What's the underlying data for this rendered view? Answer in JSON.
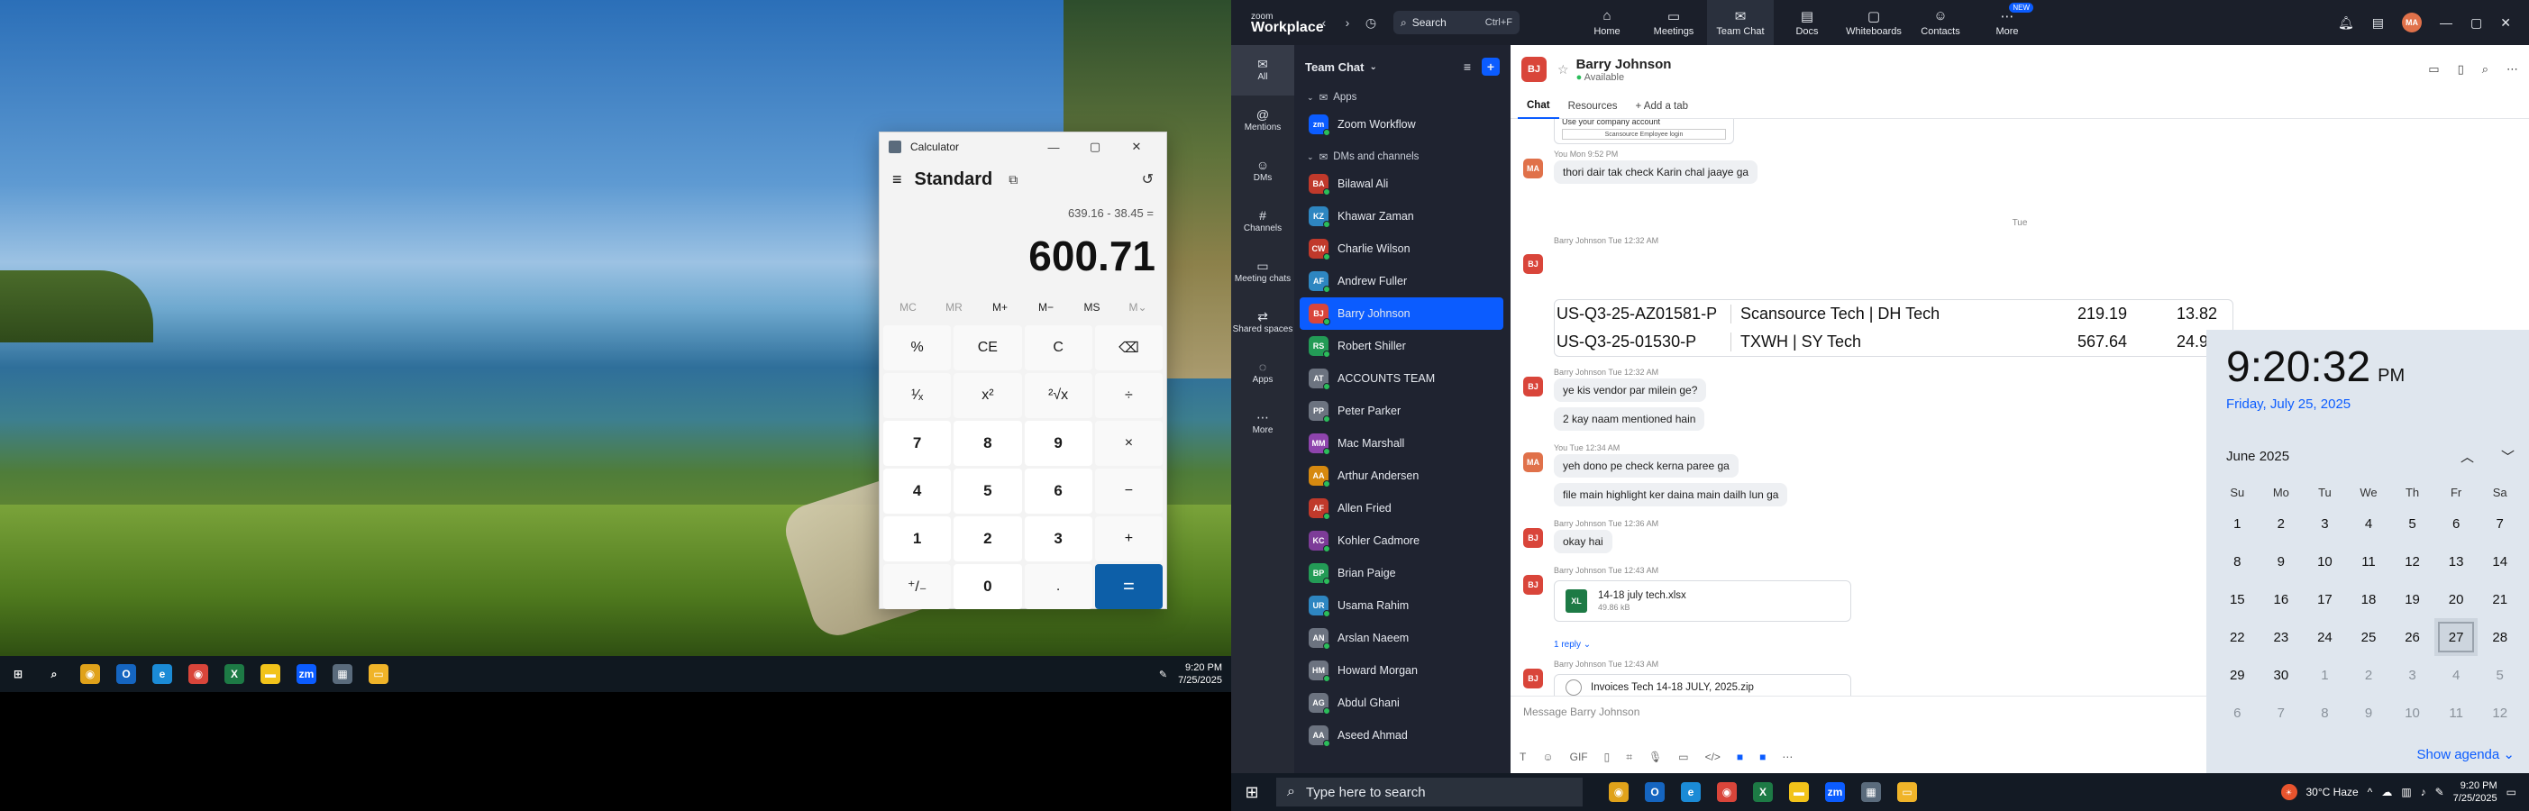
{
  "left_taskbar": {
    "time": "9:20 PM",
    "date": "7/25/2025",
    "apps": [
      {
        "name": "windows-start-icon",
        "glyph": "⊞",
        "color": "#ffffff"
      },
      {
        "name": "search-icon",
        "glyph": "⌕",
        "color": "#ffffff"
      },
      {
        "name": "chrome-icon",
        "glyph": "◉",
        "color": "#e0a21a"
      },
      {
        "name": "outlook-icon",
        "glyph": "O",
        "color": "#1565c0"
      },
      {
        "name": "edge-icon",
        "glyph": "e",
        "color": "#1b8bd6"
      },
      {
        "name": "chrome-icon-2",
        "glyph": "◉",
        "color": "#d9453a"
      },
      {
        "name": "excel-icon",
        "glyph": "X",
        "color": "#1d7a45"
      },
      {
        "name": "sticky-notes-icon",
        "glyph": "▬",
        "color": "#f2c31a"
      },
      {
        "name": "zoom-icon",
        "glyph": "zm",
        "color": "#0b5cff"
      },
      {
        "name": "calculator-icon",
        "glyph": "▦",
        "color": "#5a6b7c"
      },
      {
        "name": "file-explorer-icon",
        "glyph": "▭",
        "color": "#f0b429"
      }
    ]
  },
  "calculator": {
    "title": "Calculator",
    "mode": "Standard",
    "expression": "639.16 - 38.45 =",
    "result": "600.71",
    "memory": [
      "MC",
      "MR",
      "M+",
      "M−",
      "MS",
      "M⌄"
    ],
    "keys": [
      {
        "label": "%",
        "type": "fn"
      },
      {
        "label": "CE",
        "type": "fn"
      },
      {
        "label": "C",
        "type": "fn"
      },
      {
        "label": "⌫",
        "type": "fn"
      },
      {
        "label": "¹⁄ₓ",
        "type": "fn"
      },
      {
        "label": "x²",
        "type": "fn"
      },
      {
        "label": "²√x",
        "type": "fn"
      },
      {
        "label": "÷",
        "type": "fn"
      },
      {
        "label": "7",
        "type": "num"
      },
      {
        "label": "8",
        "type": "num"
      },
      {
        "label": "9",
        "type": "num"
      },
      {
        "label": "×",
        "type": "fn"
      },
      {
        "label": "4",
        "type": "num"
      },
      {
        "label": "5",
        "type": "num"
      },
      {
        "label": "6",
        "type": "num"
      },
      {
        "label": "−",
        "type": "fn"
      },
      {
        "label": "1",
        "type": "num"
      },
      {
        "label": "2",
        "type": "num"
      },
      {
        "label": "3",
        "type": "num"
      },
      {
        "label": "+",
        "type": "fn"
      },
      {
        "label": "⁺/₋",
        "type": "fn"
      },
      {
        "label": "0",
        "type": "num"
      },
      {
        "label": ".",
        "type": "fn"
      },
      {
        "label": "=",
        "type": "eq"
      }
    ]
  },
  "zoom": {
    "logo_top": "zoom",
    "logo_bottom": "Workplace",
    "search_label": "Search",
    "search_shortcut": "Ctrl+F",
    "nav": [
      {
        "label": "Home",
        "icon": "⌂",
        "active": false
      },
      {
        "label": "Meetings",
        "icon": "▭",
        "active": false
      },
      {
        "label": "Team Chat",
        "icon": "✉",
        "active": true
      },
      {
        "label": "Docs",
        "icon": "▤",
        "active": false
      },
      {
        "label": "Whiteboards",
        "icon": "▢",
        "active": false
      },
      {
        "label": "Contacts",
        "icon": "☺",
        "active": false
      },
      {
        "label": "More",
        "icon": "⋯",
        "active": false,
        "badge": "NEW"
      }
    ],
    "avatar_initials": "MA",
    "rail": [
      {
        "label": "All",
        "icon": "✉",
        "active": true
      },
      {
        "label": "Mentions",
        "icon": "@",
        "active": false
      },
      {
        "label": "DMs",
        "icon": "☺",
        "active": false
      },
      {
        "label": "Channels",
        "icon": "#",
        "active": false
      },
      {
        "label": "Meeting chats",
        "icon": "▭",
        "active": false
      },
      {
        "label": "Shared spaces",
        "icon": "⇄",
        "active": false
      },
      {
        "label": "Apps",
        "icon": "◌",
        "active": false
      },
      {
        "label": "More",
        "icon": "⋯",
        "active": false
      }
    ],
    "chat_list_title": "Team Chat",
    "apps_section": "Apps",
    "apps": [
      {
        "label": "Zoom Workflow",
        "initials": "zm",
        "color": "#0b5cff"
      }
    ],
    "dms_section": "DMs and channels",
    "dms": [
      {
        "label": "Bilawal Ali",
        "initials": "BA",
        "color": "#c0392b",
        "active": false
      },
      {
        "label": "Khawar Zaman",
        "initials": "KZ",
        "color": "#2e86c1",
        "active": false
      },
      {
        "label": "Charlie Wilson",
        "initials": "CW",
        "color": "#c0392b",
        "active": false
      },
      {
        "label": "Andrew Fuller",
        "initials": "AF",
        "color": "#2e86c1",
        "active": false
      },
      {
        "label": "Barry Johnson",
        "initials": "BJ",
        "color": "#d9453a",
        "active": true
      },
      {
        "label": "Robert Shiller",
        "initials": "RS",
        "color": "#239b56",
        "active": false
      },
      {
        "label": "ACCOUNTS TEAM",
        "initials": "AT",
        "color": "#6c7380",
        "active": false
      },
      {
        "label": "Peter Parker",
        "initials": "PP",
        "color": "#6c7380",
        "active": false
      },
      {
        "label": "Mac Marshall",
        "initials": "MM",
        "color": "#8e44ad",
        "active": false
      },
      {
        "label": "Arthur Andersen",
        "initials": "AA",
        "color": "#d68910",
        "active": false
      },
      {
        "label": "Allen Fried",
        "initials": "AF",
        "color": "#c0392b",
        "active": false
      },
      {
        "label": "Kohler Cadmore",
        "initials": "KC",
        "color": "#7d3c98",
        "active": false
      },
      {
        "label": "Brian Paige",
        "initials": "BP",
        "color": "#239b56",
        "active": false
      },
      {
        "label": "Usama Rahim",
        "initials": "UR",
        "color": "#2e86c1",
        "active": false
      },
      {
        "label": "Arslan Naeem",
        "initials": "AN",
        "color": "#6c7380",
        "active": false
      },
      {
        "label": "Howard Morgan",
        "initials": "HM",
        "color": "#6c7380",
        "active": false
      },
      {
        "label": "Abdul Ghani",
        "initials": "AG",
        "color": "#6c7380",
        "active": false
      },
      {
        "label": "Aseed Ahmad",
        "initials": "AA",
        "color": "#6c7380",
        "active": false
      }
    ],
    "chat": {
      "contact_name": "Barry Johnson",
      "contact_initials": "BJ",
      "contact_status": "Available",
      "tabs": [
        "Chat",
        "Resources",
        "+ Add a tab"
      ],
      "link_preview_line1": "Use your company account",
      "link_preview_line2": "Scansource Employee login",
      "messages": [
        {
          "meta": "You Mon 9:52 PM",
          "text": "thori dair tak check Karin chal jaaye ga",
          "initials": "MA",
          "color": "#e0714a"
        },
        {
          "meta": "Barry Johnson Tue 12:32 AM",
          "text": "",
          "initials": "BJ",
          "color": "#d9453a"
        },
        {
          "meta": "Barry Johnson Tue 12:32 AM",
          "text": "ye kis vendor par milein ge?",
          "initials": "BJ",
          "color": "#d9453a"
        },
        {
          "meta": "",
          "text": "2 kay naam mentioned hain",
          "initials": "",
          "color": ""
        },
        {
          "meta": "You Tue 12:34 AM",
          "text": "yeh dono pe check kerna paree ga",
          "initials": "MA",
          "color": "#e0714a"
        },
        {
          "meta": "",
          "text": "file main highlight ker daina main dailh lun ga",
          "initials": "",
          "color": ""
        },
        {
          "meta": "Barry Johnson Tue 12:36 AM",
          "text": "okay hai",
          "initials": "BJ",
          "color": "#d9453a"
        },
        {
          "meta": "Barry Johnson Tue 12:43 AM",
          "text": "",
          "initials": "BJ",
          "color": "#d9453a"
        },
        {
          "meta": "Barry Johnson Tue 12:43 AM",
          "text": "",
          "initials": "BJ",
          "color": "#d9453a"
        }
      ],
      "day_separator": "Tue",
      "table_rows": [
        [
          "US-Q3-25-AZ01581-P",
          "Scansource Tech | DH Tech",
          "219.19",
          "13.82"
        ],
        [
          "US-Q3-25-01530-P",
          "TXWH | SY Tech",
          "567.64",
          "24.94"
        ]
      ],
      "file1_name": "14-18 july tech.xlsx",
      "file1_size": "49.86 kB",
      "reply_count": "1 reply",
      "file2_name": "Invoices Tech 14-18 JULY, 2025.zip",
      "composer_placeholder": "Message Barry Johnson"
    }
  },
  "calendar": {
    "time": "9:20:32",
    "ampm": "PM",
    "full_date": "Friday, July 25, 2025",
    "month_label": "June 2025",
    "dow": [
      "Su",
      "Mo",
      "Tu",
      "We",
      "Th",
      "Fr",
      "Sa"
    ],
    "days": [
      {
        "d": "1",
        "other": false
      },
      {
        "d": "2",
        "other": false
      },
      {
        "d": "3",
        "other": false
      },
      {
        "d": "4",
        "other": false
      },
      {
        "d": "5",
        "other": false
      },
      {
        "d": "6",
        "other": false
      },
      {
        "d": "7",
        "other": false
      },
      {
        "d": "8",
        "other": false
      },
      {
        "d": "9",
        "other": false
      },
      {
        "d": "10",
        "other": false
      },
      {
        "d": "11",
        "other": false
      },
      {
        "d": "12",
        "other": false
      },
      {
        "d": "13",
        "other": false
      },
      {
        "d": "14",
        "other": false
      },
      {
        "d": "15",
        "other": false
      },
      {
        "d": "16",
        "other": false
      },
      {
        "d": "17",
        "other": false
      },
      {
        "d": "18",
        "other": false
      },
      {
        "d": "19",
        "other": false
      },
      {
        "d": "20",
        "other": false
      },
      {
        "d": "21",
        "other": false
      },
      {
        "d": "22",
        "other": false
      },
      {
        "d": "23",
        "other": false
      },
      {
        "d": "24",
        "other": false
      },
      {
        "d": "25",
        "other": false
      },
      {
        "d": "26",
        "other": false
      },
      {
        "d": "27",
        "other": false,
        "today": true
      },
      {
        "d": "28",
        "other": false
      },
      {
        "d": "29",
        "other": false
      },
      {
        "d": "30",
        "other": false
      },
      {
        "d": "1",
        "other": true
      },
      {
        "d": "2",
        "other": true
      },
      {
        "d": "3",
        "other": true
      },
      {
        "d": "4",
        "other": true
      },
      {
        "d": "5",
        "other": true
      },
      {
        "d": "6",
        "other": true
      },
      {
        "d": "7",
        "other": true
      },
      {
        "d": "8",
        "other": true
      },
      {
        "d": "9",
        "other": true
      },
      {
        "d": "10",
        "other": true
      },
      {
        "d": "11",
        "other": true
      },
      {
        "d": "12",
        "other": true
      }
    ],
    "agenda_label": "Show agenda"
  },
  "right_taskbar": {
    "search_placeholder": "Type here to search",
    "weather": "30°C  Haze",
    "time": "9:20 PM",
    "date": "7/25/2025",
    "apps": [
      {
        "name": "chrome-icon",
        "glyph": "◉",
        "color": "#e0a21a"
      },
      {
        "name": "outlook-icon",
        "glyph": "O",
        "color": "#1565c0"
      },
      {
        "name": "edge-icon",
        "glyph": "e",
        "color": "#1b8bd6"
      },
      {
        "name": "chrome-icon-2",
        "glyph": "◉",
        "color": "#d9453a"
      },
      {
        "name": "excel-icon",
        "glyph": "X",
        "color": "#1d7a45"
      },
      {
        "name": "sticky-notes-icon",
        "glyph": "▬",
        "color": "#f2c31a"
      },
      {
        "name": "zoom-icon",
        "glyph": "zm",
        "color": "#0b5cff"
      },
      {
        "name": "calculator-icon",
        "glyph": "▦",
        "color": "#5a6b7c"
      },
      {
        "name": "file-explorer-icon",
        "glyph": "▭",
        "color": "#f0b429"
      }
    ]
  }
}
